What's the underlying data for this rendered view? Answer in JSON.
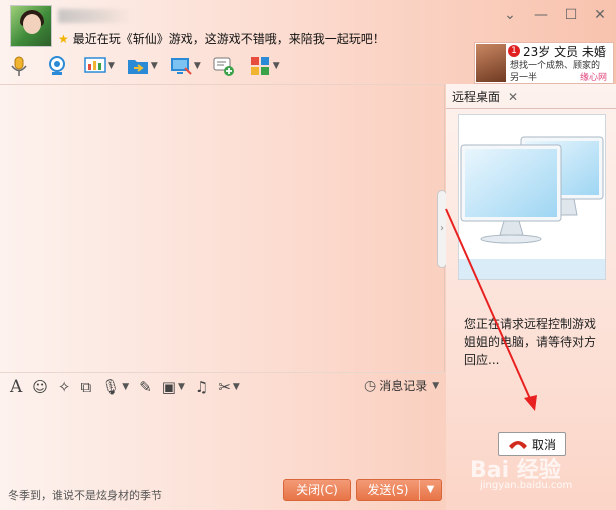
{
  "header": {
    "signature": "最近在玩《斩仙》游戏，这游戏不错哦，来陪我一起玩吧！",
    "window_controls": [
      "chevron-down-icon",
      "minimize-icon",
      "maximize-icon",
      "close-icon"
    ]
  },
  "ad": {
    "badge": "1",
    "line1": "23岁 文员 未婚",
    "line2": "想找一个成熟、顾家的",
    "line3": "另一半",
    "brand": "缘心网"
  },
  "toolbar": {
    "icons": [
      "microphone-icon",
      "webcam-icon",
      "screen-share-icon",
      "file-transfer-icon",
      "remote-desktop-icon",
      "message-add-icon",
      "apps-icon"
    ]
  },
  "remote": {
    "tab_label": "远程桌面",
    "status_text": "您正在请求远程控制游戏姐姐的电脑，请等待对方回应...",
    "cancel_label": "取消"
  },
  "format_bar": {
    "icons": [
      "font-icon",
      "emoji-icon",
      "magic-icon",
      "screenshot-icon",
      "voice-icon",
      "edit-icon",
      "image-icon",
      "music-icon",
      "scissors-icon"
    ],
    "history_label": "消息记录"
  },
  "footer": {
    "tip": "冬季到，谁说不是炫身材的季节",
    "close_label": "关闭(C)",
    "send_label": "发送(S)"
  },
  "watermark": {
    "main": "Bai 经验",
    "sub": "jingyan.baidu.com"
  }
}
